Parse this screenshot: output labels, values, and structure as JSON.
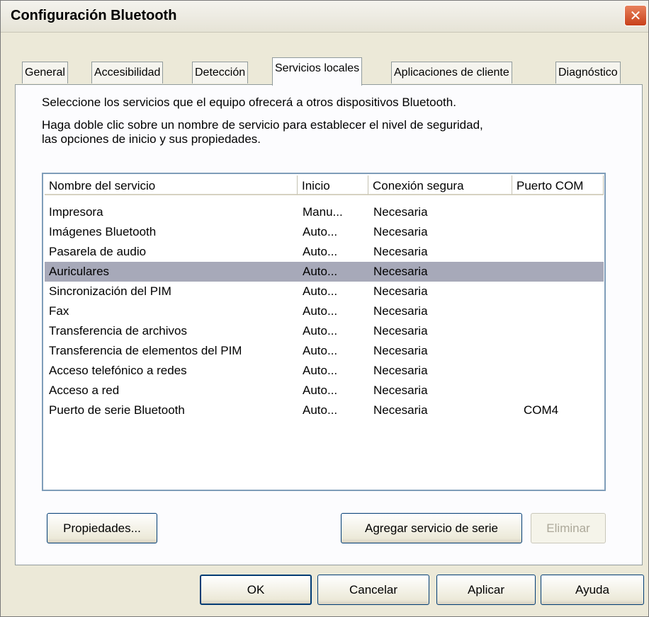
{
  "window": {
    "title": "Configuración Bluetooth"
  },
  "tabs": [
    {
      "label": "General",
      "active": false
    },
    {
      "label": "Accesibilidad",
      "active": false
    },
    {
      "label": "Detección",
      "active": false
    },
    {
      "label": "Servicios locales",
      "active": true
    },
    {
      "label": "Aplicaciones de cliente",
      "active": false
    },
    {
      "label": "Diagnóstico",
      "active": false
    }
  ],
  "panel": {
    "description1": "Seleccione los servicios que el equipo ofrecerá a otros dispositivos Bluetooth.",
    "description2_line1": "Haga doble clic sobre un nombre de servicio para establecer el nivel de seguridad,",
    "description2_line2": "las opciones de inicio y sus propiedades."
  },
  "services_table": {
    "columns": [
      "Nombre del servicio",
      "Inicio",
      "Conexión segura",
      "Puerto COM"
    ],
    "rows": [
      {
        "name": "Impresora",
        "start": "Manu...",
        "secure": "Necesaria",
        "com": ""
      },
      {
        "name": "Imágenes Bluetooth",
        "start": "Auto...",
        "secure": "Necesaria",
        "com": ""
      },
      {
        "name": "Pasarela de audio",
        "start": "Auto...",
        "secure": "Necesaria",
        "com": ""
      },
      {
        "name": "Auriculares",
        "start": "Auto...",
        "secure": "Necesaria",
        "com": "",
        "selected": true
      },
      {
        "name": "Sincronización del PIM",
        "start": "Auto...",
        "secure": "Necesaria",
        "com": ""
      },
      {
        "name": "Fax",
        "start": "Auto...",
        "secure": "Necesaria",
        "com": ""
      },
      {
        "name": "Transferencia de archivos",
        "start": "Auto...",
        "secure": "Necesaria",
        "com": ""
      },
      {
        "name": "Transferencia de elementos del PIM",
        "start": "Auto...",
        "secure": "Necesaria",
        "com": ""
      },
      {
        "name": "Acceso telefónico a redes",
        "start": "Auto...",
        "secure": "Necesaria",
        "com": ""
      },
      {
        "name": "Acceso a red",
        "start": "Auto...",
        "secure": "Necesaria",
        "com": ""
      },
      {
        "name": "Puerto de serie Bluetooth",
        "start": "Auto...",
        "secure": "Necesaria",
        "com": "COM4"
      }
    ]
  },
  "panel_buttons": {
    "properties": "Propiedades...",
    "add_serial": "Agregar servicio de serie",
    "remove": "Eliminar"
  },
  "dialog_buttons": {
    "ok": "OK",
    "cancel": "Cancelar",
    "apply": "Aplicar",
    "help": "Ayuda"
  },
  "colors": {
    "dialog_bg": "#ece9d8",
    "selection": "#a7a9b9",
    "close_button": "#d9552b"
  },
  "icons": {
    "close": "close-icon"
  }
}
